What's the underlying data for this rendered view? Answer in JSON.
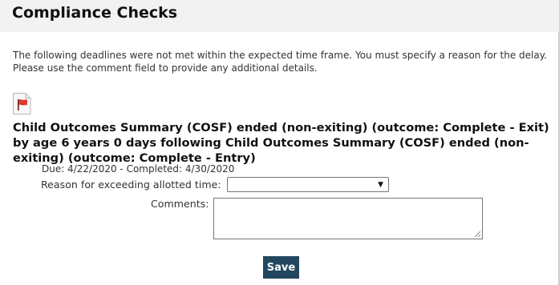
{
  "header": {
    "title": "Compliance Checks"
  },
  "intro_text": "The following deadlines were not met within the expected time frame. You must specify a reason for the delay. Please use the comment field to provide any additional details.",
  "item": {
    "icon": "red-flag-document-icon",
    "title": "Child Outcomes Summary (COSF) ended (non-exiting) (outcome: Complete - Exit) by age 6 years 0 days following Child Outcomes Summary (COSF) ended (non-exiting) (outcome: Complete - Entry)",
    "due_completed": "Due: 4/22/2020 - Completed: 4/30/2020",
    "reason_label": "Reason for exceeding allotted time:",
    "reason_value": "",
    "comments_label": "Comments:",
    "comments_value": ""
  },
  "actions": {
    "save_label": "Save"
  },
  "colors": {
    "header_bg": "#f2f2f2",
    "save_button_bg": "#22475f",
    "flag_red": "#e03a2e"
  }
}
